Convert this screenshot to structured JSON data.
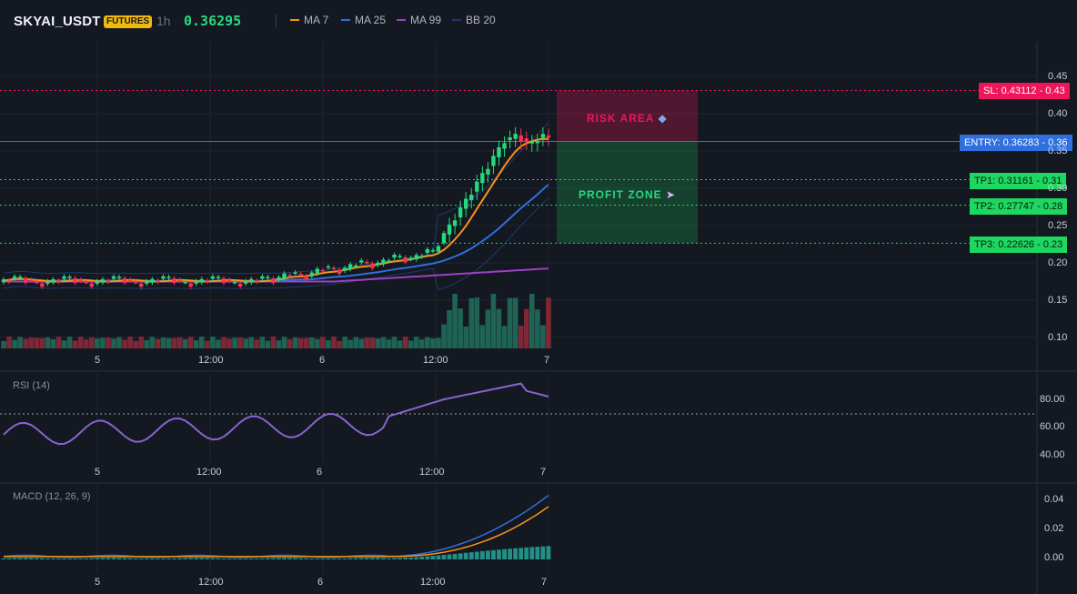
{
  "header": {
    "symbol": "SKYAI_USDT",
    "badge": "FUTURES",
    "timeframe": "1h",
    "price": "0.36295",
    "indicators": [
      {
        "label": "MA 7",
        "color": "#f7931a"
      },
      {
        "label": "MA 25",
        "color": "#2f6fde"
      },
      {
        "label": "MA 99",
        "color": "#a13fc6"
      },
      {
        "label": "BB 20",
        "color": "#1e3a6e"
      }
    ]
  },
  "main_chart": {
    "y_ticks": [
      "0.45",
      "0.40",
      "0.35",
      "0.30",
      "0.25",
      "0.20",
      "0.15",
      "0.10"
    ],
    "x_ticks": [
      "5",
      "12:00",
      "6",
      "12:00",
      "7"
    ],
    "risk_label": "RISK AREA",
    "profit_label": "PROFIT ZONE",
    "levels": {
      "sl": "SL: 0.43112 - 0.43",
      "entry": "ENTRY: 0.36283 - 0.36",
      "tp1": "TP1: 0.31161 - 0.31",
      "tp2": "TP2: 0.27747 - 0.28",
      "tp3": "TP3: 0.22626 - 0.23"
    }
  },
  "rsi": {
    "label": "RSI (14)",
    "y_ticks": [
      "80.00",
      "60.00",
      "40.00"
    ],
    "x_ticks": [
      "5",
      "12:00",
      "6",
      "12:00",
      "7"
    ]
  },
  "macd": {
    "label": "MACD (12, 26, 9)",
    "y_ticks": [
      "0.04",
      "0.02",
      "0.00"
    ],
    "x_ticks": [
      "5",
      "12:00",
      "6",
      "12:00",
      "7"
    ]
  },
  "colors": {
    "up": "#26d97f",
    "down": "#f23655",
    "entry": "#2f6fde",
    "sl": "#f0145a",
    "tp": "#1ed760"
  }
}
